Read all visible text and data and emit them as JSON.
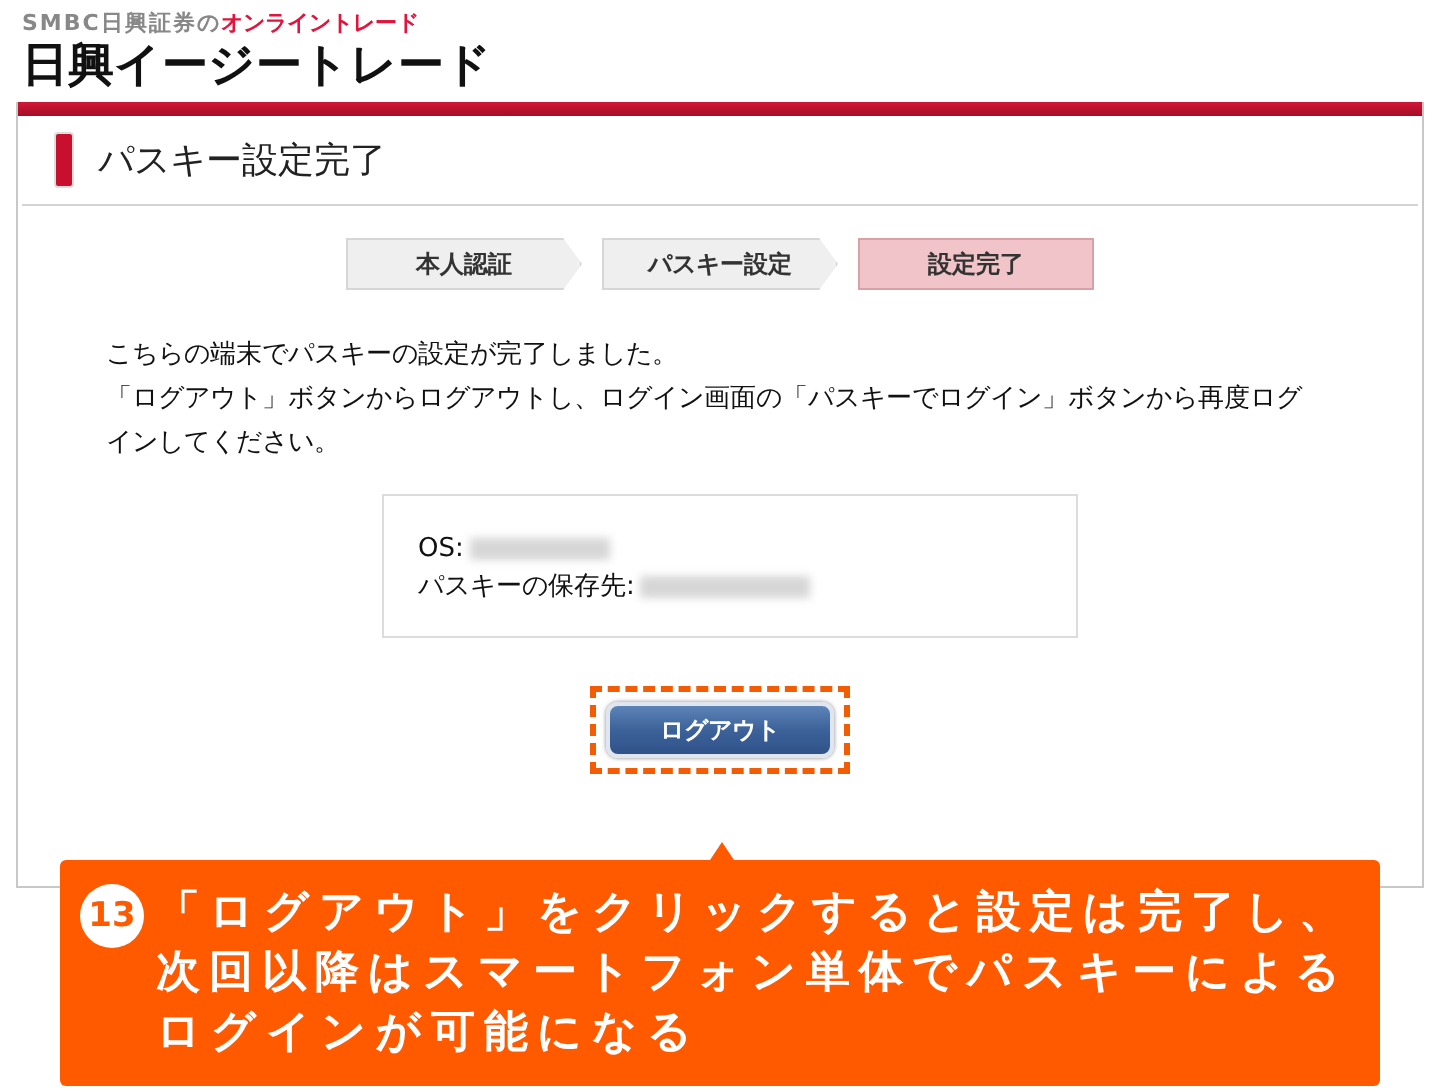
{
  "header": {
    "brand_prefix": "SMBC日興証券の",
    "brand_suffix": "オンライントレード",
    "logo": "日興イージートレード"
  },
  "page_title": "パスキー設定完了",
  "steps": [
    {
      "label": "本人認証",
      "selected": false
    },
    {
      "label": "パスキー設定",
      "selected": false
    },
    {
      "label": "設定完了",
      "selected": true
    }
  ],
  "message": [
    "こちらの端末でパスキーの設定が完了しました。",
    "「ログアウト」ボタンからログアウトし、ログイン画面の「パスキーでログイン」ボタンから再度ログインしてください。"
  ],
  "info": [
    {
      "label": "OS:"
    },
    {
      "label": "パスキーの保存先:"
    }
  ],
  "logout_button": "ログアウト",
  "callout": {
    "number": "13",
    "lines": [
      "「ログアウト」をクリックすると設定は完了し、",
      "次回以降はスマートフォン単体でパスキーによる",
      "ログインが可能になる"
    ]
  }
}
